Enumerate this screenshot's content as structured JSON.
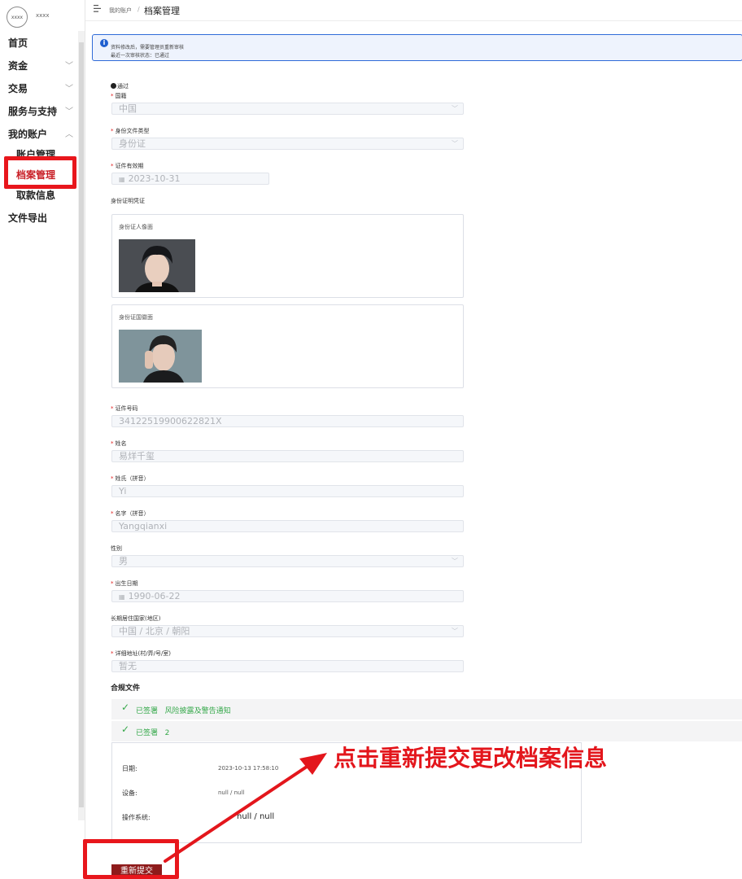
{
  "logo": {
    "badge": "xxxx",
    "text": "xxxx"
  },
  "sidebar": {
    "items": [
      {
        "label": "首页"
      },
      {
        "label": "资金"
      },
      {
        "label": "交易"
      },
      {
        "label": "服务与支持"
      },
      {
        "label": "我的账户"
      },
      {
        "label": "文件导出"
      }
    ],
    "sub_items": [
      {
        "label": "账户管理"
      },
      {
        "label": "档案管理"
      },
      {
        "label": "取款信息"
      }
    ]
  },
  "breadcrumb": {
    "parent": "我的账户",
    "current": "档案管理"
  },
  "alert": {
    "line1": "资料修改后，需要管理员重新审核",
    "line2": "最近一次审核状态：已通过"
  },
  "status": {
    "passed": "通过"
  },
  "form": {
    "nationality": {
      "label": "国籍",
      "value": "中国"
    },
    "id_type": {
      "label": "身份文件类型",
      "value": "身份证"
    },
    "id_expiry": {
      "label": "证件有效期",
      "value": "2023-10-31"
    },
    "id_proof": {
      "label": "身份证明凭证",
      "front_label": "身份证人像面",
      "back_label": "身份证国徽面"
    },
    "id_number": {
      "label": "证件号码",
      "value": "341225199006228​21X"
    },
    "full_name": {
      "label": "姓名",
      "value": "易烊千玺"
    },
    "surname_pinyin": {
      "label": "姓氏（拼音）",
      "value": "Yi"
    },
    "given_pinyin": {
      "label": "名字（拼音）",
      "value": "Yangqianxi"
    },
    "gender": {
      "label": "性别",
      "value": "男"
    },
    "birth_date": {
      "label": "出生日期",
      "value": "1990-06-22"
    },
    "residence": {
      "label": "长期居住国家(地区)",
      "value": "中国 / 北京 / 朝阳"
    },
    "address": {
      "label": "详细地址(村/弄/号/室)",
      "value": "暂无"
    }
  },
  "compliance": {
    "title": "合规文件",
    "rows": [
      {
        "status": "已签署",
        "doc": "风险披露及警告通知"
      },
      {
        "status": "已签署",
        "doc": "2"
      }
    ],
    "detail": {
      "date_label": "日期:",
      "date_value": "2023-10-13 17:58:10",
      "device_label": "设备:",
      "device_value": "null / null",
      "os_label": "操作系统:",
      "os_value": "null / null"
    }
  },
  "resubmit_label": "重新提交",
  "annotation": "点击重新提交更改档案信息",
  "colors": {
    "accent_red": "#e3161c",
    "button_dark_red": "#8e1b1b",
    "signed_green": "#35a84a",
    "alert_blue": "#2f6bd8"
  },
  "icons": [
    "menu-icon",
    "info-icon",
    "chevron-down-icon",
    "chevron-up-icon",
    "calendar-icon",
    "check-icon",
    "arrow-annotation"
  ]
}
